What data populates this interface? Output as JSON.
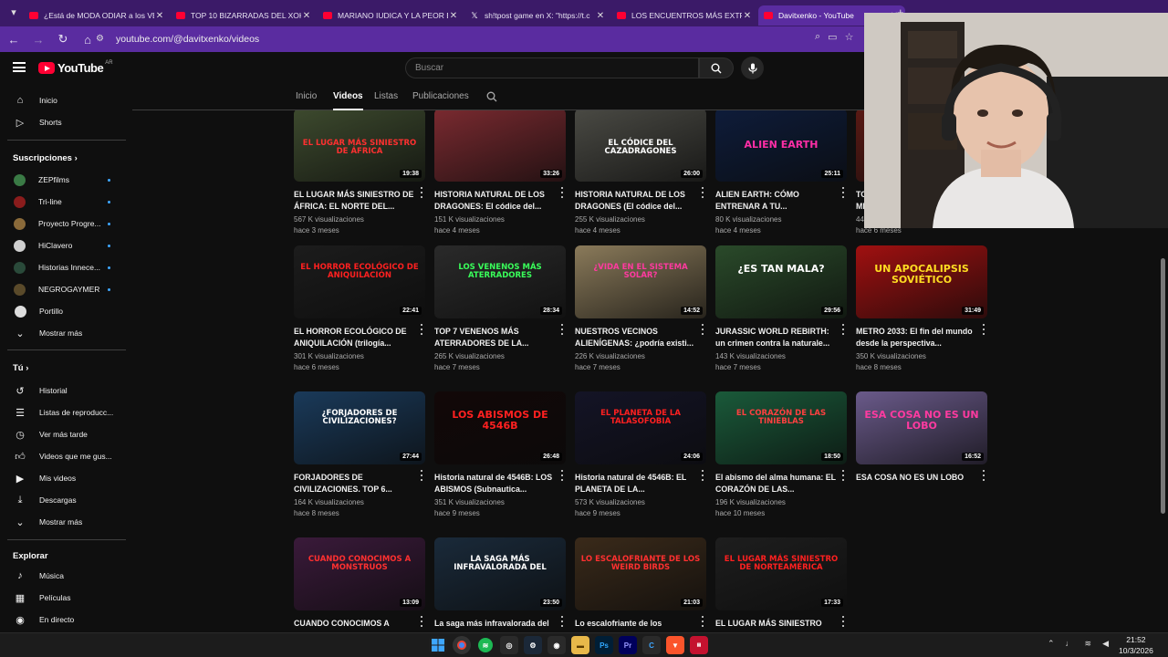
{
  "browser": {
    "tabs": [
      {
        "title": "¿Está de MODA ODIAR a los VE",
        "icon": "youtube-icon"
      },
      {
        "title": "TOP 10 BIZARRADAS DEL XOK/",
        "icon": "youtube-icon"
      },
      {
        "title": "MARIANO IUDICA Y LA PEOR E",
        "icon": "youtube-icon"
      },
      {
        "title": "sh!tpost game en X: \"https://t.c",
        "icon": "x-icon"
      },
      {
        "title": "LOS ENCUENTROS MÁS EXTRA",
        "icon": "youtube-icon"
      },
      {
        "title": "Davitxenko - YouTube",
        "icon": "youtube-icon",
        "active": true
      }
    ],
    "url": "youtube.com/@davitxenko/videos"
  },
  "header": {
    "logo_text": "YouTube",
    "country_code": "AR",
    "search_placeholder": "Buscar"
  },
  "channel_tabs": [
    "Inicio",
    "Videos",
    "Listas",
    "Publicaciones"
  ],
  "sidebar": {
    "main": [
      {
        "label": "Inicio",
        "icon": "home-icon"
      },
      {
        "label": "Shorts",
        "icon": "shorts-icon"
      }
    ],
    "subs_header": "Suscripciones",
    "subscriptions": [
      {
        "label": "ZEPfilms",
        "color": "#3a7a45"
      },
      {
        "label": "Tri-line",
        "color": "#8a1c1c"
      },
      {
        "label": "Proyecto Progre...",
        "color": "#8a6a3a"
      },
      {
        "label": "HiClavero",
        "color": "#cfcfcf"
      },
      {
        "label": "Historias Innece...",
        "color": "#2a4a3a"
      },
      {
        "label": "NEGROGAYMER",
        "color": "#5a4a2a"
      },
      {
        "label": "Portillo",
        "color": "#dddddd"
      }
    ],
    "show_more": "Mostrar más",
    "you_header": "Tú",
    "you": [
      {
        "label": "Historial",
        "icon": "history-icon"
      },
      {
        "label": "Listas de reproducc...",
        "icon": "playlists-icon"
      },
      {
        "label": "Ver más tarde",
        "icon": "watch-later-icon"
      },
      {
        "label": "Videos que me gus...",
        "icon": "like-icon"
      },
      {
        "label": "Mis videos",
        "icon": "my-videos-icon"
      },
      {
        "label": "Descargas",
        "icon": "download-icon"
      },
      {
        "label": "Mostrar más",
        "icon": "chevron-down-icon"
      }
    ],
    "explore_header": "Explorar",
    "explore": [
      {
        "label": "Música",
        "icon": "music-icon"
      },
      {
        "label": "Películas",
        "icon": "movie-icon"
      },
      {
        "label": "En directo",
        "icon": "live-icon"
      }
    ]
  },
  "videos": [
    {
      "title": "EL LUGAR MÁS SINIESTRO DE ÁFRICA: EL NORTE DEL...",
      "views": "567 K visualizaciones",
      "age": "hace 3 meses",
      "duration": "19:38",
      "thumb_text": "EL LUGAR MÁS SINIESTRO DE ÁFRICA",
      "bg": "#3d4a2e",
      "fg": "#ff3030"
    },
    {
      "title": "HISTORIA NATURAL DE LOS DRAGONES: El códice del...",
      "views": "151 K visualizaciones",
      "age": "hace 4 meses",
      "duration": "33:26",
      "thumb_text": "",
      "bg": "#7a2a30",
      "fg": "#ffffff"
    },
    {
      "title": "HISTORIA NATURAL DE LOS DRAGONES (El códice del...",
      "views": "255 K visualizaciones",
      "age": "hace 4 meses",
      "duration": "26:00",
      "thumb_text": "EL CÓDICE DEL CAZADRAGONES",
      "bg": "#4a4a44",
      "fg": "#ffffff"
    },
    {
      "title": "ALIEN EARTH: CÓMO ENTRENAR A TU...",
      "views": "80 K visualizaciones",
      "age": "hace 4 meses",
      "duration": "25:11",
      "thumb_text": "ALIEN EARTH",
      "bg": "#0e1c3a",
      "fg": "#ff2ea6"
    },
    {
      "title": "TOP 6 CRÍPTIDOS MÁS MISTERIOSOS",
      "views": "445 K visualizaciones",
      "age": "hace 6 meses",
      "duration": "24:01",
      "thumb_text": "LOS CRÍPTIDOS MÁS MISTERIOSOS",
      "bg": "#5a1a14",
      "fg": "#ffffff"
    },
    {
      "title": "EL HORROR ECOLÓGICO DE ANIQUILACIÓN (trilogía...",
      "views": "301 K visualizaciones",
      "age": "hace 6 meses",
      "duration": "22:41",
      "thumb_text": "EL HORROR ECOLÓGICO DE ANIQUILACIÓN",
      "bg": "#1c1c1c",
      "fg": "#ff2020"
    },
    {
      "title": "TOP 7 VENENOS MÁS ATERRADORES DE LA...",
      "views": "265 K visualizaciones",
      "age": "hace 7 meses",
      "duration": "28:34",
      "thumb_text": "LOS VENENOS MÁS ATERRADORES",
      "bg": "#2a2a2a",
      "fg": "#39ff5a"
    },
    {
      "title": "NUESTROS VECINOS ALIENÍGENAS: ¿podría existi...",
      "views": "226 K visualizaciones",
      "age": "hace 7 meses",
      "duration": "14:52",
      "thumb_text": "¿VIDA EN EL SISTEMA SOLAR?",
      "bg": "#8a7a5a",
      "fg": "#ff3aa0"
    },
    {
      "title": "JURASSIC WORLD REBIRTH: un crimen contra la naturale...",
      "views": "143 K visualizaciones",
      "age": "hace 7 meses",
      "duration": "29:56",
      "thumb_text": "¿ES TAN MALA?",
      "bg": "#2a4a2a",
      "fg": "#ffffff"
    },
    {
      "title": "METRO 2033: El fin del mundo desde la perspectiva...",
      "views": "350 K visualizaciones",
      "age": "hace 8 meses",
      "duration": "31:49",
      "thumb_text": "UN APOCALIPSIS SOVIÉTICO",
      "bg": "#a01010",
      "fg": "#ffdd22"
    },
    {
      "title": "FORJADORES DE CIVILIZACIONES. TOP 6...",
      "views": "164 K visualizaciones",
      "age": "hace 8 meses",
      "duration": "27:44",
      "thumb_text": "¿FORJADORES DE CIVILIZACIONES?",
      "bg": "#1a3a5a",
      "fg": "#ffffff"
    },
    {
      "title": "Historia natural de 4546B: LOS ABISMOS (Subnautica...",
      "views": "351 K visualizaciones",
      "age": "hace 9 meses",
      "duration": "26:48",
      "thumb_text": "LOS ABISMOS DE 4546B",
      "bg": "#120808",
      "fg": "#ff2020"
    },
    {
      "title": "Historia natural de 4546B: EL PLANETA DE LA...",
      "views": "573 K visualizaciones",
      "age": "hace 9 meses",
      "duration": "24:06",
      "thumb_text": "EL PLANETA DE LA TALASOFOBIA",
      "bg": "#141426",
      "fg": "#ff2020"
    },
    {
      "title": "El abismo del alma humana: EL CORAZÓN DE LAS...",
      "views": "196 K visualizaciones",
      "age": "hace 10 meses",
      "duration": "18:50",
      "thumb_text": "EL CORAZÓN DE LAS TINIEBLAS",
      "bg": "#1a5a3a",
      "fg": "#ff4040"
    },
    {
      "title": "ESA COSA NO ES UN LOBO",
      "views": "",
      "age": "",
      "duration": "16:52",
      "thumb_text": "ESA COSA NO ES UN LOBO",
      "bg": "#6a5a8a",
      "fg": "#ff3aa0"
    },
    {
      "title": "CUANDO CONOCIMOS A",
      "views": "",
      "age": "",
      "duration": "13:09",
      "thumb_text": "CUANDO CONOCIMOS A MONSTRUOS",
      "bg": "#3a1a3a",
      "fg": "#ff3030"
    },
    {
      "title": "La saga más infravalorada del",
      "views": "",
      "age": "",
      "duration": "23:50",
      "thumb_text": "LA SAGA MÁS INFRAVALORADA DEL",
      "bg": "#1a2a3a",
      "fg": "#ffffff"
    },
    {
      "title": "Lo escalofriante de los",
      "views": "",
      "age": "",
      "duration": "21:03",
      "thumb_text": "LO ESCALOFRIANTE DE LOS WEIRD BIRDS",
      "bg": "#3a2a1a",
      "fg": "#ff3030"
    },
    {
      "title": "EL LUGAR MÁS SINIESTRO",
      "views": "",
      "age": "",
      "duration": "17:33",
      "thumb_text": "EL LUGAR MÁS SINIESTRO DE NORTEAMÉRICA",
      "bg": "#1e1e1e",
      "fg": "#ff2020"
    }
  ],
  "clock": {
    "time": "21:52",
    "date": "10/3/2026"
  }
}
